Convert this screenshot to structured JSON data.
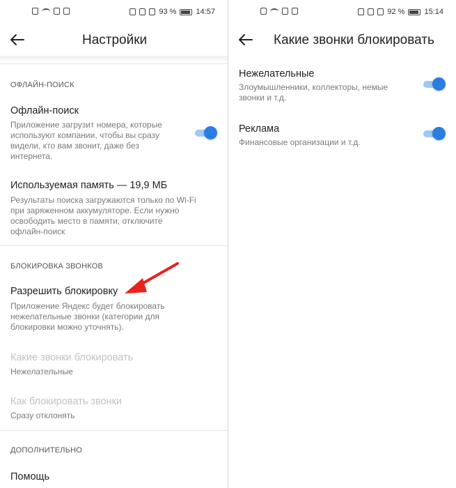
{
  "left": {
    "status": {
      "battery": "93 %",
      "time": "14:57"
    },
    "title": "Настройки",
    "offline_section": {
      "header": "ОФЛАЙН-ПОИСК",
      "offline_title": "Офлайн-поиск",
      "offline_desc": [
        "Приложение загрузит номера, которые",
        "используют компании, чтобы вы сразу",
        "видели, кто вам звонит, даже без",
        "интернета."
      ],
      "offline_toggle": "on",
      "memory_title": "Используемая память — 19,9 МБ",
      "memory_desc": [
        "Результаты поиска загружаются только по Wi-Fi",
        "при заряженном аккумуляторе. Если нужно",
        "освободить место в памяти, отключите",
        "офлайн-поиск"
      ]
    },
    "block_section": {
      "header": "БЛОКИРОВКА ЗВОНКОВ",
      "allow_title": "Разрешить блокировку",
      "allow_desc": [
        "Приложение Яндекс будет блокировать",
        "нежелательные звонки (категории для",
        "блокировки можно уточнять)."
      ],
      "which_title": "Какие звонки блокировать",
      "which_value": "Нежелательные",
      "how_title": "Как блокировать звонки",
      "how_value": "Сразу отклонять"
    },
    "extra_section": {
      "header": "ДОПОЛНИТЕЛЬНО",
      "help": "Помощь"
    }
  },
  "right": {
    "status": {
      "battery": "92 %",
      "time": "15:14"
    },
    "title": "Какие звонки блокировать",
    "items": [
      {
        "title": "Нежелательные",
        "desc": [
          "Злоумышленники, коллекторы, немые",
          "звонки и т.д."
        ],
        "toggle": "on"
      },
      {
        "title": "Реклама",
        "desc": [
          "Финансовые организации и т.д."
        ],
        "toggle": "on"
      }
    ]
  },
  "colors": {
    "accent": "#2a7de1",
    "arrow": "#e8231c",
    "disabled_text": "#c2c2c2"
  }
}
